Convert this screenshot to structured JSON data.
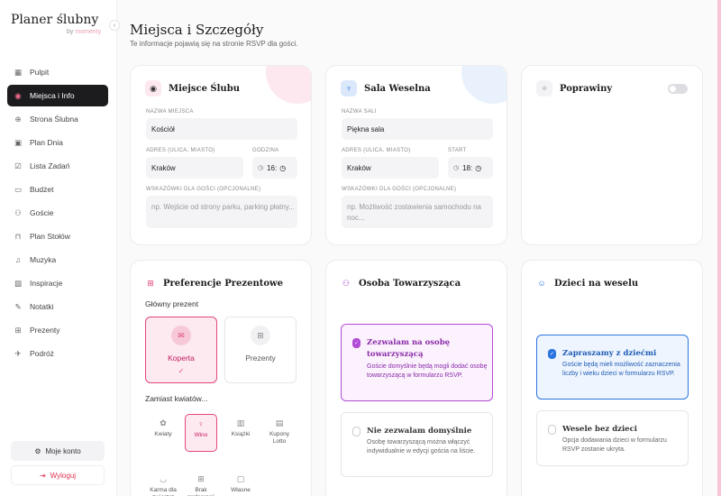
{
  "brand": {
    "title": "Planer ślubny",
    "by": "by",
    "name": "momenty"
  },
  "nav": [
    {
      "label": "Pulpit",
      "icon": "grid-icon",
      "glyph": "▦",
      "active": false
    },
    {
      "label": "Miejsca i Info",
      "icon": "location-pin-icon",
      "glyph": "◉",
      "active": true
    },
    {
      "label": "Strona Ślubna",
      "icon": "globe-icon",
      "glyph": "⊕",
      "active": false
    },
    {
      "label": "Plan Dnia",
      "icon": "calendar-icon",
      "glyph": "▣",
      "active": false
    },
    {
      "label": "Lista Zadań",
      "icon": "checklist-icon",
      "glyph": "☑",
      "active": false
    },
    {
      "label": "Budżet",
      "icon": "wallet-icon",
      "glyph": "▭",
      "active": false
    },
    {
      "label": "Goście",
      "icon": "users-icon",
      "glyph": "⚇",
      "active": false
    },
    {
      "label": "Plan Stołów",
      "icon": "table-icon",
      "glyph": "⊓",
      "active": false
    },
    {
      "label": "Muzyka",
      "icon": "music-icon",
      "glyph": "♫",
      "active": false
    },
    {
      "label": "Inspiracje",
      "icon": "image-icon",
      "glyph": "▨",
      "active": false
    },
    {
      "label": "Notatki",
      "icon": "notes-icon",
      "glyph": "✎",
      "active": false
    },
    {
      "label": "Prezenty",
      "icon": "gift-icon",
      "glyph": "⊞",
      "active": false
    },
    {
      "label": "Podróż",
      "icon": "plane-icon",
      "glyph": "✈",
      "active": false
    }
  ],
  "account": {
    "my_account": "Moje konto",
    "logout": "Wyloguj"
  },
  "header": {
    "title": "Miejsca i Szczegóły",
    "subtitle": "Te informacje pojawią się na stronie RSVP dla gości."
  },
  "ceremony": {
    "title": "Miejsce Ślubu",
    "name_label": "NAZWA MIEJSCA",
    "name_value": "Kościół",
    "address_label": "ADRES (ULICA, MIASTO)",
    "address_value": "Kraków",
    "time_label": "GODZINA",
    "time_value": "16:",
    "hints_label": "WSKAZÓWKI DLA GOŚCI (OPCJONALNE)",
    "hints_placeholder": "np. Wejście od strony parku, parking płatny..."
  },
  "reception": {
    "title": "Sala Weselna",
    "name_label": "NAZWA SALI",
    "name_value": "Piękna sala",
    "address_label": "ADRES (ULICA, MIASTO)",
    "address_value": "Kraków",
    "time_label": "START",
    "time_value": "18:",
    "hints_label": "WSKAZÓWKI DLA GOŚCI (OPCJONALNE)",
    "hints_placeholder": "np. Możliwość zostawienia samochodu na noc..."
  },
  "afterparty": {
    "title": "Poprawiny",
    "enabled": false
  },
  "gifts": {
    "title": "Preferencje Prezentowe",
    "main_label": "Główny prezent",
    "options": [
      {
        "label": "Koperta",
        "selected": true
      },
      {
        "label": "Prezenty",
        "selected": false
      }
    ],
    "flowers_label": "Zamiast kwiatów...",
    "flowers": [
      {
        "label": "Kwiaty",
        "icon": "flower-icon",
        "glyph": "✿"
      },
      {
        "label": "Wino",
        "icon": "wine-icon",
        "glyph": "♀"
      },
      {
        "label": "Książki",
        "icon": "book-icon",
        "glyph": "▥"
      },
      {
        "label": "Kupony Lotto",
        "icon": "ticket-icon",
        "glyph": "▤"
      },
      {
        "label": "Karma dla zwierząt",
        "icon": "pet-icon",
        "glyph": "◡"
      },
      {
        "label": "Brak preferencji",
        "icon": "gift-icon",
        "glyph": "⊞"
      },
      {
        "label": "Własne",
        "icon": "chat-icon",
        "glyph": "▢"
      }
    ]
  },
  "companion": {
    "title": "Osoba Towarzysząca",
    "allow_title": "Zezwalam na osobę towarzyszącą",
    "allow_desc": "Goście domyślnie będą mogli dodać osobę towarzyszącą w formularzu RSVP.",
    "deny_title": "Nie zezwalam domyślnie",
    "deny_desc": "Osobę towarzyszącą można włączyć indywidualnie w edycji gościa na liście."
  },
  "children": {
    "title": "Dzieci na weselu",
    "allow_title": "Zapraszamy z dziećmi",
    "allow_desc": "Goście będą mieli możliwość zaznaczenia liczby i wieku dzieci w formularzu RSVP.",
    "deny_title": "Wesele bez dzieci",
    "deny_desc": "Opcja dodawania dzieci w formularzu RSVP zostanie ukryta."
  },
  "colors": {
    "accent": "#e2477a",
    "purple": "#b14ad6",
    "blue": "#2b75e0",
    "dark": "#1c1c1e"
  }
}
